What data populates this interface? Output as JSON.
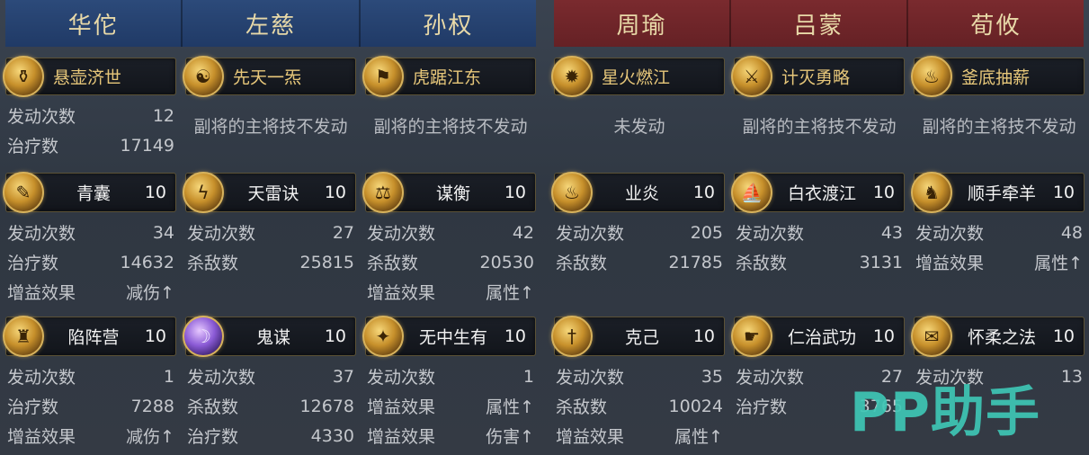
{
  "teams": {
    "left": [
      "华佗",
      "左慈",
      "孙权"
    ],
    "right": [
      "周瑜",
      "吕蒙",
      "荀攸"
    ]
  },
  "columns": [
    {
      "main": {
        "name": "悬壶济世",
        "icon": "gourd-icon",
        "stats": [
          {
            "k": "发动次数",
            "v": "12"
          },
          {
            "k": "治疗数",
            "v": "17149"
          }
        ]
      },
      "skills": [
        {
          "name": "青囊",
          "level": "10",
          "icon": "scroll-icon",
          "stats": [
            {
              "k": "发动次数",
              "v": "34"
            },
            {
              "k": "治疗数",
              "v": "14632"
            },
            {
              "k": "增益效果",
              "v": "减伤↑"
            }
          ]
        },
        {
          "name": "陷阵营",
          "level": "10",
          "icon": "soldier-icon",
          "stats": [
            {
              "k": "发动次数",
              "v": "1"
            },
            {
              "k": "治疗数",
              "v": "7288"
            },
            {
              "k": "增益效果",
              "v": "减伤↑"
            }
          ]
        }
      ]
    },
    {
      "main": {
        "name": "先天一炁",
        "icon": "meditate-icon",
        "note": "副将的主将技不发动"
      },
      "skills": [
        {
          "name": "天雷诀",
          "level": "10",
          "icon": "lightning-icon",
          "stats": [
            {
              "k": "发动次数",
              "v": "27"
            },
            {
              "k": "杀敌数",
              "v": "25815"
            }
          ]
        },
        {
          "name": "鬼谋",
          "level": "10",
          "icon": "ghost-icon",
          "purple": true,
          "stats": [
            {
              "k": "发动次数",
              "v": "37"
            },
            {
              "k": "杀敌数",
              "v": "12678"
            },
            {
              "k": "治疗数",
              "v": "4330"
            }
          ]
        }
      ]
    },
    {
      "main": {
        "name": "虎踞江东",
        "icon": "banner-icon",
        "note": "副将的主将技不发动"
      },
      "skills": [
        {
          "name": "谋衡",
          "level": "10",
          "icon": "balance-icon",
          "stats": [
            {
              "k": "发动次数",
              "v": "42"
            },
            {
              "k": "杀敌数",
              "v": "20530"
            },
            {
              "k": "增益效果",
              "v": "属性↑"
            }
          ]
        },
        {
          "name": "无中生有",
          "level": "10",
          "icon": "spark-icon",
          "stats": [
            {
              "k": "发动次数",
              "v": "1"
            },
            {
              "k": "增益效果",
              "v": "属性↑"
            },
            {
              "k": "增益效果",
              "v": "伤害↑"
            }
          ]
        }
      ]
    },
    {
      "main": {
        "name": "星火燃江",
        "icon": "fire-icon",
        "note": "未发动"
      },
      "skills": [
        {
          "name": "业炎",
          "level": "10",
          "icon": "flame-icon",
          "stats": [
            {
              "k": "发动次数",
              "v": "205"
            },
            {
              "k": "杀敌数",
              "v": "21785"
            }
          ]
        },
        {
          "name": "克己",
          "level": "10",
          "icon": "sword-icon",
          "stats": [
            {
              "k": "发动次数",
              "v": "35"
            },
            {
              "k": "杀敌数",
              "v": "10024"
            },
            {
              "k": "增益效果",
              "v": "属性↑"
            }
          ]
        }
      ]
    },
    {
      "main": {
        "name": "计灭勇略",
        "icon": "slash-icon",
        "note": "副将的主将技不发动"
      },
      "skills": [
        {
          "name": "白衣渡江",
          "level": "10",
          "icon": "boat-icon",
          "stats": [
            {
              "k": "发动次数",
              "v": "43"
            },
            {
              "k": "杀敌数",
              "v": "3131"
            }
          ]
        },
        {
          "name": "仁治武功",
          "level": "10",
          "icon": "hand-icon",
          "stats": [
            {
              "k": "发动次数",
              "v": "27"
            },
            {
              "k": "治疗数",
              "v": "3765"
            }
          ]
        }
      ]
    },
    {
      "main": {
        "name": "釜底抽薪",
        "icon": "tripod-icon",
        "note": "副将的主将技不发动"
      },
      "skills": [
        {
          "name": "顺手牵羊",
          "level": "10",
          "icon": "sheep-icon",
          "stats": [
            {
              "k": "发动次数",
              "v": "48"
            },
            {
              "k": "增益效果",
              "v": "属性↑"
            }
          ]
        },
        {
          "name": "怀柔之法",
          "level": "10",
          "icon": "book-icon",
          "stats": [
            {
              "k": "发动次数",
              "v": "13"
            }
          ]
        }
      ]
    }
  ],
  "watermark": "PP助手"
}
